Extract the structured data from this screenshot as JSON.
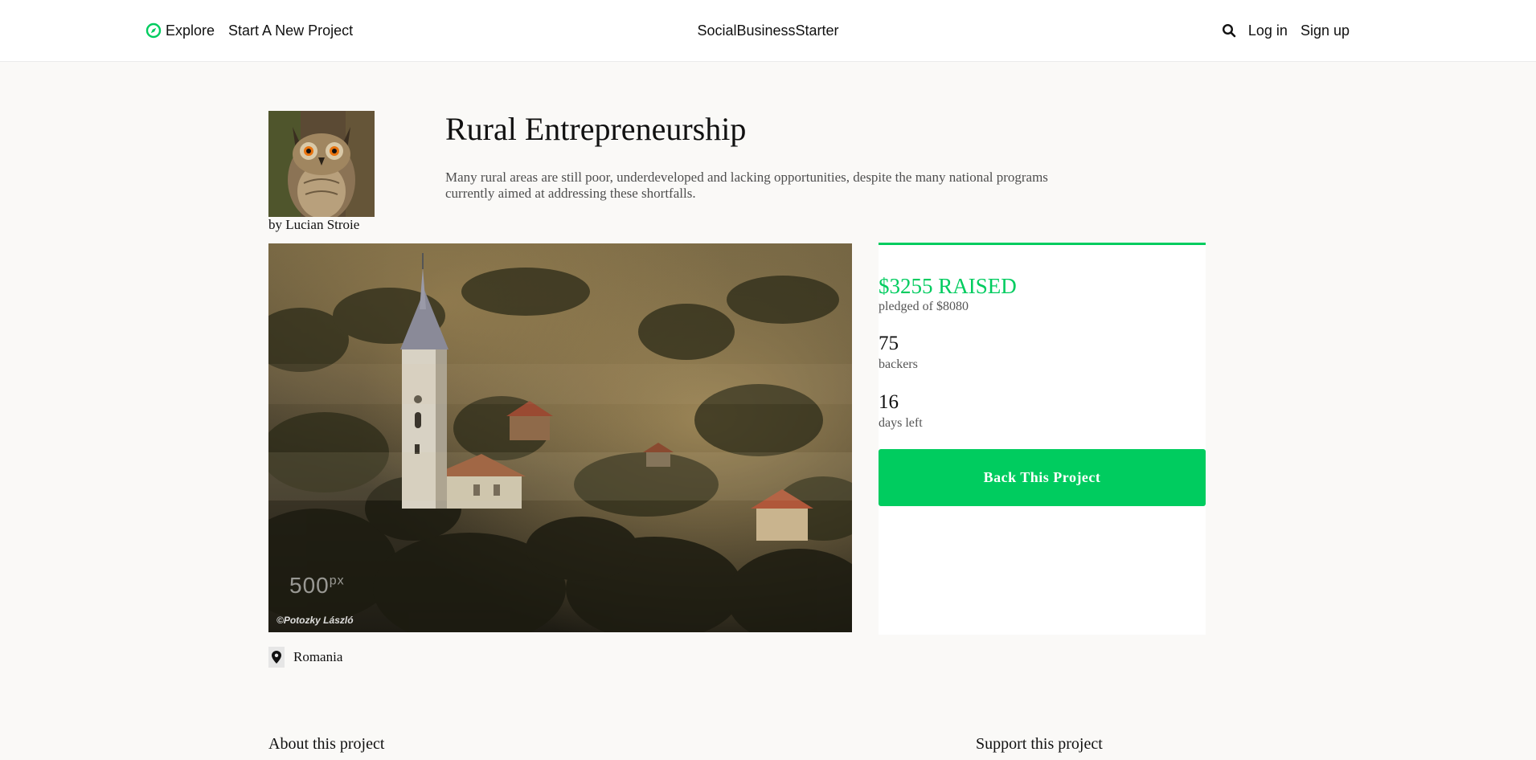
{
  "header": {
    "explore_label": "Explore",
    "start_project_label": "Start A New Project",
    "brand": "SocialBusinessStarter",
    "login_label": "Log in",
    "signup_label": "Sign up",
    "explore_icon": "compass-icon",
    "search_icon": "search-icon"
  },
  "project": {
    "title": "Rural Entrepreneurship",
    "blurb": "Many rural areas are still poor, underdeveloped and lacking opportunities, despite the many national programs currently aimed at addressing these shortfalls.",
    "byline": "by Lucian Stroie",
    "avatar_icon": "owl-avatar",
    "location_icon": "map-pin-icon",
    "location": "Romania",
    "image_watermark": "500",
    "image_watermark_sup": "px",
    "image_credit": "©Potozky László"
  },
  "stats": {
    "raised": "$3255 RAISED",
    "pledged": "pledged of $8080",
    "backers_count": "75",
    "backers_label": "backers",
    "days_count": "16",
    "days_label": "days left",
    "back_button_label": "Back This Project"
  },
  "sections": {
    "about_heading": "About this project",
    "support_heading": "Support this project"
  },
  "colors": {
    "accent": "#00cc5f",
    "header_bg": "#ffffff",
    "page_bg": "#faf9f7"
  }
}
